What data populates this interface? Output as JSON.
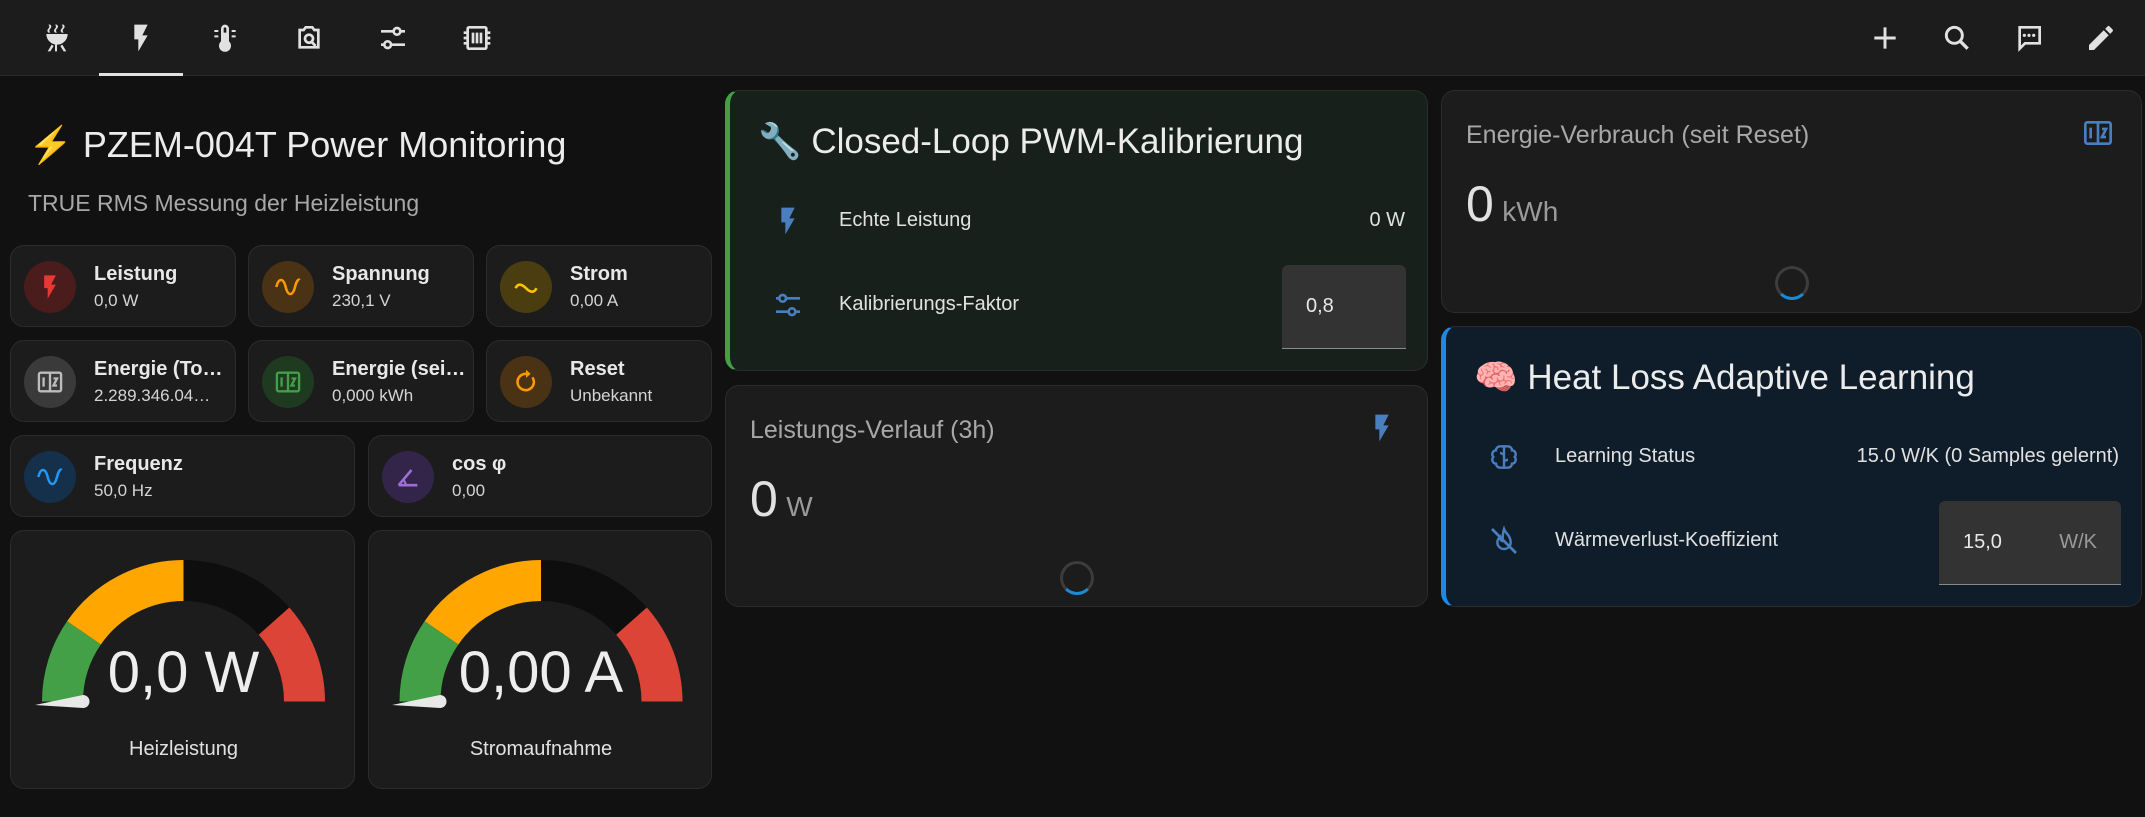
{
  "topbar": {
    "tabs": [
      {
        "icon": "grill-icon"
      },
      {
        "icon": "lightning-bolt-icon"
      },
      {
        "icon": "thermometer-icon"
      },
      {
        "icon": "camera-search-icon"
      },
      {
        "icon": "tune-sliders-icon"
      },
      {
        "icon": "memory-chip-icon"
      }
    ],
    "active_tab": 1,
    "actions": [
      {
        "icon": "plus-icon"
      },
      {
        "icon": "search-icon"
      },
      {
        "icon": "chat-icon"
      },
      {
        "icon": "pencil-icon"
      }
    ]
  },
  "pzem": {
    "title_emoji": "⚡",
    "title": "PZEM-004T Power Monitoring",
    "subtitle": "TRUE RMS Messung der Heizleistung"
  },
  "tiles": [
    {
      "name": "Leistung",
      "value": "0,0 W",
      "icon": "flash-alert-icon",
      "color": "#e53935",
      "bg": "#4a1c1c"
    },
    {
      "name": "Spannung",
      "value": "230,1 V",
      "icon": "sine-wave-icon",
      "color": "#ff9800",
      "bg": "#4a3215"
    },
    {
      "name": "Strom",
      "value": "0,00 A",
      "icon": "current-ac-icon",
      "color": "#ffc107",
      "bg": "#4a3d10"
    },
    {
      "name": "Energie (To…",
      "value": "2.289.346.04…",
      "icon": "counter-icon",
      "color": "#bdbdbd",
      "bg": "#3a3a3a"
    },
    {
      "name": "Energie (sei…",
      "value": "0,000 kWh",
      "icon": "counter-icon",
      "color": "#43a047",
      "bg": "#1e3a20"
    },
    {
      "name": "Reset",
      "value": "Unbekannt",
      "icon": "restart-icon",
      "color": "#ff9800",
      "bg": "#4a3215"
    },
    {
      "name": "Frequenz",
      "value": "50,0 Hz",
      "icon": "sine-wave-icon",
      "color": "#2196f3",
      "bg": "#15304a"
    },
    {
      "name": "cos φ",
      "value": "0,00",
      "icon": "angle-acute-icon",
      "color": "#9c6fd6",
      "bg": "#33254a"
    }
  ],
  "gauges": [
    {
      "value_text": "0,0 W",
      "label": "Heizleistung",
      "level": 0
    },
    {
      "value_text": "0,00 A",
      "label": "Stromaufnahme",
      "level": 0
    }
  ],
  "pwm": {
    "emoji": "🔧",
    "title": "Closed-Loop PWM-Kalibrierung",
    "rows": [
      {
        "label": "Echte Leistung",
        "value": "0 W"
      },
      {
        "label": "Kalibrierungs-Faktor",
        "input_value": "0,8"
      }
    ],
    "accent": "#43a047"
  },
  "verlauf": {
    "title": "Leistungs-Verlauf (3h)",
    "value": "0",
    "unit": "W"
  },
  "energie": {
    "title": "Energie-Verbrauch (seit Reset)",
    "value": "0",
    "unit": "kWh"
  },
  "heatloss": {
    "emoji": "🧠",
    "title": "Heat Loss Adaptive Learning",
    "rows": [
      {
        "label": "Learning Status",
        "value": "15.0 W/K (0 Samples gelernt)"
      },
      {
        "label": "Wärmeverlust-Koeffizient",
        "input_value": "15,0",
        "input_unit": "W/K"
      }
    ],
    "accent": "#1e88e5"
  }
}
